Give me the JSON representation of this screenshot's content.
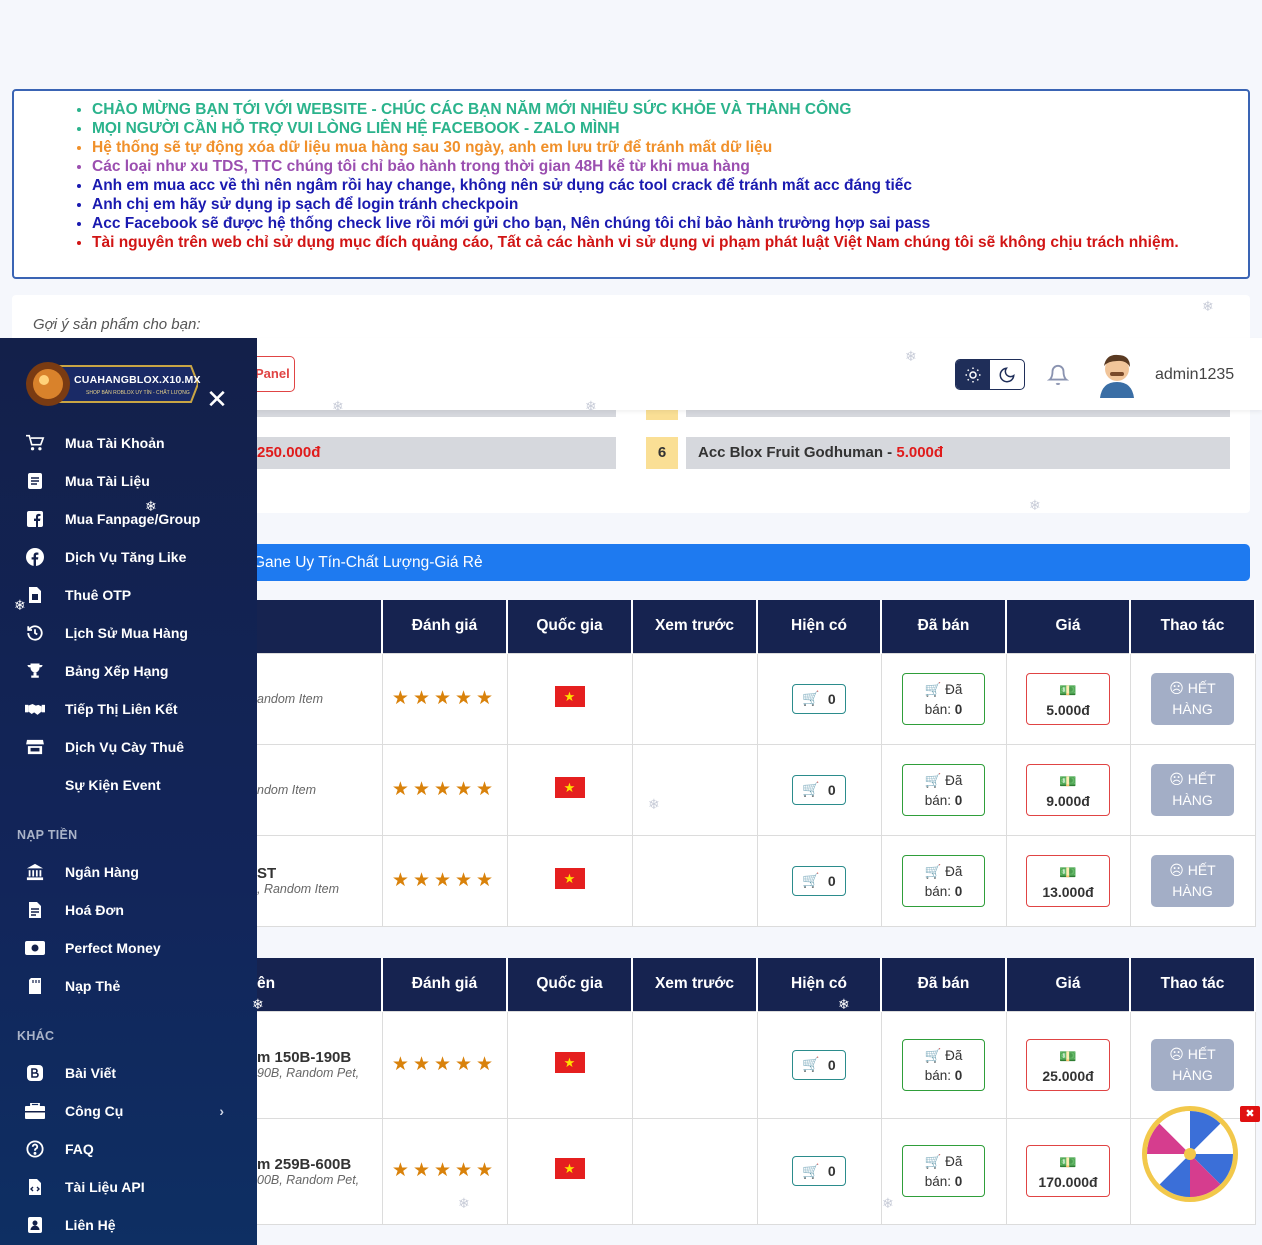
{
  "notice": {
    "lines": [
      {
        "text": "CHÀO MỪNG BẠN TỚI VỚI WEBSITE - CHÚC CÁC BẠN NĂM MỚI NHIỀU SỨC KHỎE VÀ THÀNH CÔNG",
        "color": "#2bb38c"
      },
      {
        "text": "MỌI NGƯỜI CẦN HỖ TRỢ VUI LÒNG LIÊN HỆ FACEBOOK - ZALO MÌNH",
        "color": "#2bb38c"
      },
      {
        "text": "Hệ thống sẽ tự động xóa dữ liệu mua hàng sau 30 ngày, anh em lưu trữ để tránh mất dữ liệu",
        "color": "#f0902a"
      },
      {
        "text": "Các loại như xu TDS, TTC chúng tôi chỉ bảo hành trong thời gian 48H kể từ khi mua hàng",
        "color": "#9b4fb0"
      },
      {
        "text": "Anh em mua acc về thì nên ngâm rồi hay change, không nên sử dụng các tool crack để tránh mất acc đáng tiếc",
        "color": "#1a1ab0"
      },
      {
        "text": "Anh chị em hãy sử dụng ip sạch để login tránh checkpoin",
        "color": "#1a1ab0"
      },
      {
        "text": "Acc Facebook sẽ được hệ thống check live rồi mới gửi cho bạn, Nên chúng tôi chỉ bảo hành trường hợp sai pass",
        "color": "#1a1ab0"
      },
      {
        "text": "Tài nguyên trên web chỉ sử dụng mục đích quảng cáo, Tất cả các hành vi sử dụng vi phạm phát luật Việt Nam chúng tôi sẽ không chịu trách nhiệm.",
        "color": "#d11515"
      }
    ]
  },
  "suggest": {
    "title": "Gợi ý sản phẩm cho bạn:",
    "left_price": "250.000đ",
    "item6_num": "6",
    "item6_name": "Acc Blox Fruit Godhuman",
    "item6_sep": " - ",
    "item6_price": "5.000đ"
  },
  "header": {
    "panel_label": "Panel",
    "username": "admin1235"
  },
  "banner": {
    "text": "Gane Uy Tín-Chất Lượng-Giá Rẻ"
  },
  "table_headers": [
    "Đánh giá",
    "Quốc gia",
    "Xem trước",
    "Hiện có",
    "Đã bán",
    "Giá",
    "Thao tác"
  ],
  "table1": {
    "first_header": "",
    "rows": [
      {
        "name": "",
        "desc": "andom Item",
        "stock": "0",
        "sold_label": "Đã",
        "sold_label2": "bán:",
        "sold": "0",
        "price": "5.000đ",
        "action1": "HẾT",
        "action2": "HÀNG"
      },
      {
        "name": "",
        "desc": "ndom Item",
        "stock": "0",
        "sold_label": "Đã",
        "sold_label2": "bán:",
        "sold": "0",
        "price": "9.000đ",
        "action1": "HẾT",
        "action2": "HÀNG"
      },
      {
        "name": "ST",
        "desc": ", Random Item",
        "stock": "0",
        "sold_label": "Đã",
        "sold_label2": "bán:",
        "sold": "0",
        "price": "13.000đ",
        "action1": "HẾT",
        "action2": "HÀNG"
      }
    ]
  },
  "table2": {
    "first_header": "ên",
    "rows": [
      {
        "name": "m 150B-190B",
        "desc": "90B, Random Pet,",
        "stock": "0",
        "sold_label": "Đã",
        "sold_label2": "bán:",
        "sold": "0",
        "price": "25.000đ",
        "action1": "HẾT",
        "action2": "HÀNG"
      },
      {
        "name": "m 259B-600B",
        "desc": "00B, Random Pet,",
        "stock": "0",
        "sold_label": "Đã",
        "sold_label2": "bán:",
        "sold": "0",
        "price": "170.000đ",
        "action1": "",
        "action2": ""
      }
    ]
  },
  "sidebar": {
    "logo_text": "CUAHANGBLOX.X10.MX",
    "logo_sub": "SHOP BÁN ROBLOX UY TÍN - CHẤT LƯỢNG",
    "items": [
      {
        "label": "Mua Tài Khoản",
        "icon": "cart-icon"
      },
      {
        "label": "Mua Tài Liệu",
        "icon": "document-icon"
      },
      {
        "label": "Mua Fanpage/Group",
        "icon": "facebook-square-icon"
      },
      {
        "label": "Dịch Vụ Tăng Like",
        "icon": "facebook-circle-icon"
      },
      {
        "label": "Thuê OTP",
        "icon": "sim-icon"
      },
      {
        "label": "Lịch Sử Mua Hàng",
        "icon": "history-icon"
      },
      {
        "label": "Bảng Xếp Hạng",
        "icon": "trophy-icon"
      },
      {
        "label": "Tiếp Thị Liên Kết",
        "icon": "handshake-icon"
      },
      {
        "label": "Dịch Vụ Cày Thuê",
        "icon": "store-icon"
      },
      {
        "label": "Sự Kiện Event",
        "icon": ""
      }
    ],
    "section_topup": "NẠP TIỀN",
    "topup_items": [
      {
        "label": "Ngân Hàng",
        "icon": "bank-icon"
      },
      {
        "label": "Hoá Đơn",
        "icon": "invoice-icon"
      },
      {
        "label": "Perfect Money",
        "icon": "money-icon"
      },
      {
        "label": "Nạp Thẻ",
        "icon": "card-icon"
      }
    ],
    "section_other": "KHÁC",
    "other_items": [
      {
        "label": "Bài Viết",
        "icon": "blog-icon"
      },
      {
        "label": "Công Cụ",
        "icon": "toolbox-icon"
      },
      {
        "label": "FAQ",
        "icon": "question-icon"
      },
      {
        "label": "Tài Liệu API",
        "icon": "api-doc-icon"
      },
      {
        "label": "Liên Hệ",
        "icon": "contact-icon"
      }
    ]
  },
  "wheel": {
    "close": "✖"
  },
  "colors": {
    "sidebar": "#13204a",
    "table_header": "#162350",
    "banner": "#1e7af0",
    "accent_red": "#e01b1b"
  }
}
